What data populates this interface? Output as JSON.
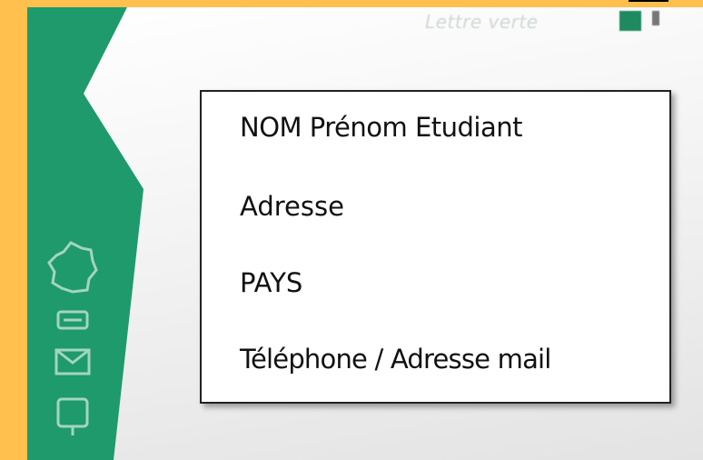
{
  "stamp": {
    "label": "Lettre verte"
  },
  "sidebar": {
    "icons": [
      "france-map-icon",
      "recycle-icon",
      "envelope-icon",
      "mailbox-icon"
    ]
  },
  "address": {
    "lines": [
      "NOM Prénom Etudiant",
      "Adresse",
      "PAYS",
      "Téléphone / Adresse mail"
    ]
  }
}
